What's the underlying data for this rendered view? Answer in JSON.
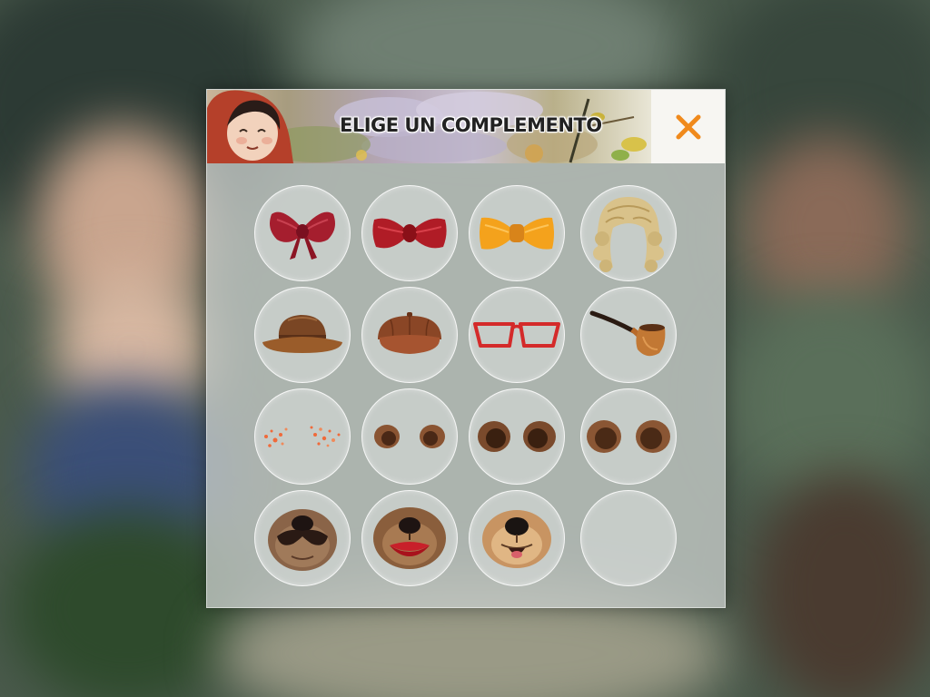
{
  "dialog": {
    "title": "ELIGE UN COMPLEMENTO",
    "close_icon": "close-x-icon",
    "accent_color": "#f08a1c"
  },
  "accessories": [
    [
      "red-bow-icon",
      "dark-red-bowtie-icon",
      "orange-bowtie-icon",
      "blonde-curly-wig-icon"
    ],
    [
      "brown-hat-icon",
      "brown-cap-icon",
      "red-glasses-icon",
      "pipe-icon"
    ],
    [
      "freckles-icon",
      "small-ears-icon",
      "medium-ears-icon",
      "large-ears-icon"
    ],
    [
      "mustache-snout-icon",
      "lipstick-snout-icon",
      "dog-snout-icon",
      "empty-slot"
    ]
  ]
}
